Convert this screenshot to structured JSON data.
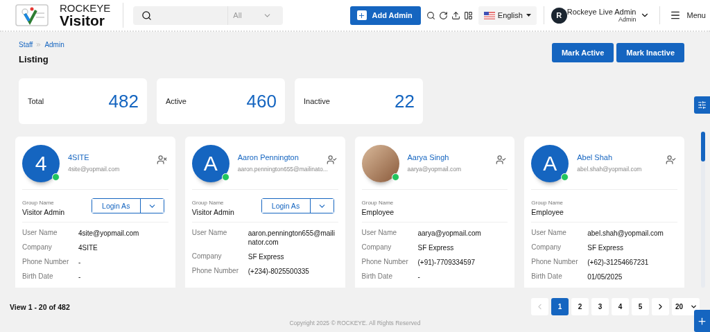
{
  "header": {
    "brand_top": "ROCKEYE",
    "brand_bottom": "Visitor",
    "search": {
      "scope": "All"
    },
    "add_button": "Add Admin",
    "language": "English",
    "user": {
      "initial": "R",
      "name": "Rockeye Live Admin",
      "role": "Admin"
    },
    "menu": "Menu"
  },
  "breadcrumb": [
    "Staff",
    "Admin"
  ],
  "page_title": "Listing",
  "actions": [
    "Mark Active",
    "Mark Inactive"
  ],
  "stats": [
    {
      "label": "Total",
      "value": "482"
    },
    {
      "label": "Active",
      "value": "460"
    },
    {
      "label": "Inactive",
      "value": "22"
    }
  ],
  "cards": [
    {
      "avatar": {
        "kind": "initial",
        "initial": "4"
      },
      "online": true,
      "name": "4SITE",
      "email": "4site@yopmail.com",
      "disabled": true,
      "group_label": "Group Name",
      "group": "Visitor Admin",
      "login_as": "Login As",
      "fields": [
        {
          "label": "User Name",
          "value": "4site@yopmail.com"
        },
        {
          "label": "Company",
          "value": "4SITE"
        },
        {
          "label": "Phone Number",
          "value": "-"
        },
        {
          "label": "Birth Date",
          "value": "-"
        }
      ]
    },
    {
      "avatar": {
        "kind": "initial",
        "initial": "A"
      },
      "online": true,
      "name": "Aaron Pennington",
      "email": "aaron.pennington655@mailinato...",
      "disabled": false,
      "group_label": "Group Name",
      "group": "Visitor Admin",
      "login_as": "Login As",
      "fields": [
        {
          "label": "User Name",
          "value": "aaron.pennington655@mailinator.com"
        },
        {
          "label": "Company",
          "value": "SF Express"
        },
        {
          "label": "Phone Number",
          "value": "(+234)-8025500335"
        }
      ]
    },
    {
      "avatar": {
        "kind": "photo"
      },
      "online": true,
      "name": "Aarya Singh",
      "email": "aarya@yopmail.com",
      "disabled": false,
      "group_label": "Group Name",
      "group": "Employee",
      "fields": [
        {
          "label": "User Name",
          "value": "aarya@yopmail.com"
        },
        {
          "label": "Company",
          "value": "SF Express"
        },
        {
          "label": "Phone Number",
          "value": "(+91)-7709334597"
        },
        {
          "label": "Birth Date",
          "value": "-"
        }
      ]
    },
    {
      "avatar": {
        "kind": "initial",
        "initial": "A"
      },
      "online": true,
      "name": "Abel Shah",
      "email": "abel.shah@yopmail.com",
      "disabled": false,
      "group_label": "Group Name",
      "group": "Employee",
      "fields": [
        {
          "label": "User Name",
          "value": "abel.shah@yopmail.com"
        },
        {
          "label": "Company",
          "value": "SF Express"
        },
        {
          "label": "Phone Number",
          "value": "(+62)-31254667231"
        },
        {
          "label": "Birth Date",
          "value": "01/05/2025"
        }
      ]
    }
  ],
  "footer": {
    "view_text": "View 1 - 20 of 482",
    "pages": [
      {
        "label": "1",
        "selected": true
      },
      {
        "label": "2",
        "selected": false
      },
      {
        "label": "3",
        "selected": false
      },
      {
        "label": "4",
        "selected": false
      },
      {
        "label": "5",
        "selected": false
      }
    ],
    "page_size": "20",
    "copyright": "Copyright 2025 © ROCKEYE. All Rights Reserved"
  }
}
